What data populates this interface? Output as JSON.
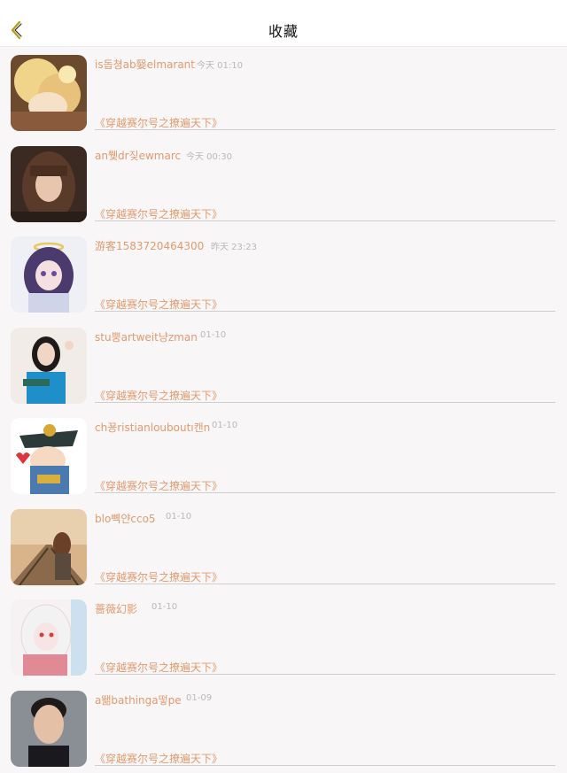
{
  "header": {
    "title": "收藏"
  },
  "items": [
    {
      "name": "is돕쳥ab嫛elmarant",
      "time": "今天 01:10",
      "book": "《穿越赛尔号之撩遍天下》",
      "avatar": "anime-blonde-avatar"
    },
    {
      "name": "an쮗dr짖ewmarc",
      "time": "今天 00:30",
      "book": "《穿越赛尔号之撩遍天下》",
      "avatar": "girl-brown-hair-avatar"
    },
    {
      "name": "游客1583720464300",
      "time": "昨天 23:23",
      "book": "《穿越赛尔号之撩遍天下》",
      "avatar": "anime-halo-girl-avatar"
    },
    {
      "name": "stu뿡artweit냥zman",
      "time": "01-10",
      "book": "《穿越赛尔号之撩遍天下》",
      "avatar": "girl-blue-shirt-avatar"
    },
    {
      "name": "ch꾱ristianlouboutı캔n",
      "time": "01-10",
      "book": "《穿越赛尔号之撩遍天下》",
      "avatar": "anime-pirate-avatar"
    },
    {
      "name": "blo뼥얀cco5",
      "time": "01-10",
      "book": "《穿越赛尔号之撩遍天下》",
      "avatar": "girl-railway-avatar"
    },
    {
      "name": "蔷薇幻影",
      "time": "01-10",
      "book": "《穿越赛尔号之撩遍天下》",
      "avatar": "anime-white-hair-avatar"
    },
    {
      "name": "a뙒bathinga떻pe",
      "time": "01-09",
      "book": "《穿越赛尔号之撩遍天下》",
      "avatar": "man-portrait-avatar"
    }
  ],
  "colors": {
    "accent": "#e29b6e",
    "time": "#b9b9b9",
    "divider": "#cfcfcf",
    "back_icon": "#b59a1e"
  }
}
